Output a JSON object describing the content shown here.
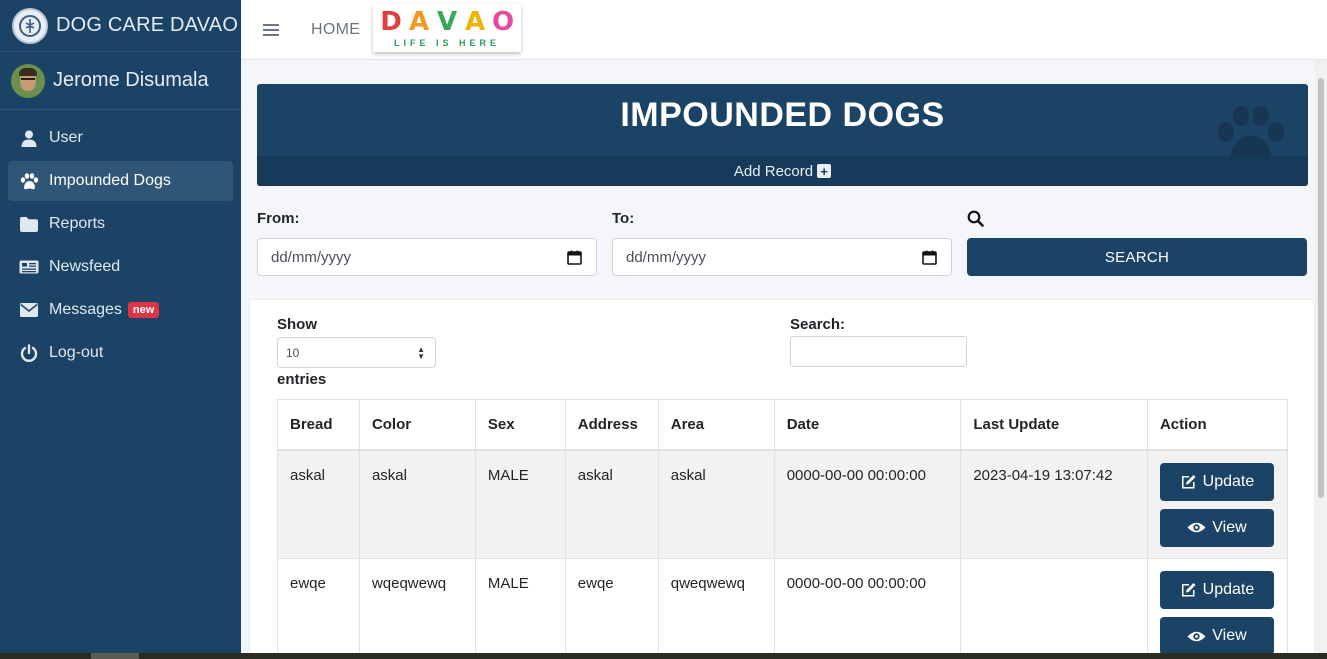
{
  "brand": {
    "title": "DOG CARE DAVAO"
  },
  "user": {
    "name": "Jerome Disumala"
  },
  "sidebar": {
    "items": [
      {
        "label": "User",
        "icon": "user-icon"
      },
      {
        "label": "Impounded Dogs",
        "icon": "paw-icon",
        "active": true
      },
      {
        "label": "Reports",
        "icon": "folder-icon"
      },
      {
        "label": "Newsfeed",
        "icon": "newspaper-icon"
      },
      {
        "label": "Messages",
        "icon": "envelope-icon",
        "badge": "new"
      },
      {
        "label": "Log-out",
        "icon": "power-icon"
      }
    ]
  },
  "topbar": {
    "home_label": "HOME",
    "logo": {
      "word": "DAVAO",
      "tagline": "LIFE IS HERE"
    }
  },
  "page": {
    "title": "IMPOUNDED DOGS",
    "add_record_label": "Add Record"
  },
  "filter": {
    "from_label": "From:",
    "to_label": "To:",
    "from_placeholder": "dd/mm/yyyy",
    "to_placeholder": "dd/mm/yyyy",
    "search_button_label": "SEARCH"
  },
  "datatable": {
    "show_label": "Show",
    "length_value": "10",
    "entries_label": "entries",
    "search_label": "Search:",
    "columns": [
      "Bread",
      "Color",
      "Sex",
      "Address",
      "Area",
      "Date",
      "Last Update",
      "Action"
    ],
    "rows": [
      {
        "bread": "askal",
        "color": "askal",
        "sex": "MALE",
        "address": "askal",
        "area": "askal",
        "date": "0000-00-00 00:00:00",
        "last_update": "2023-04-19 13:07:42"
      },
      {
        "bread": "ewqe",
        "color": "wqeqwewq",
        "sex": "MALE",
        "address": "ewqe",
        "area": "qweqwewq",
        "date": "0000-00-00 00:00:00",
        "last_update": ""
      }
    ],
    "update_label": "Update",
    "view_label": "View"
  },
  "colors": {
    "primary": "#1b4366",
    "badge": "#dc3545"
  }
}
